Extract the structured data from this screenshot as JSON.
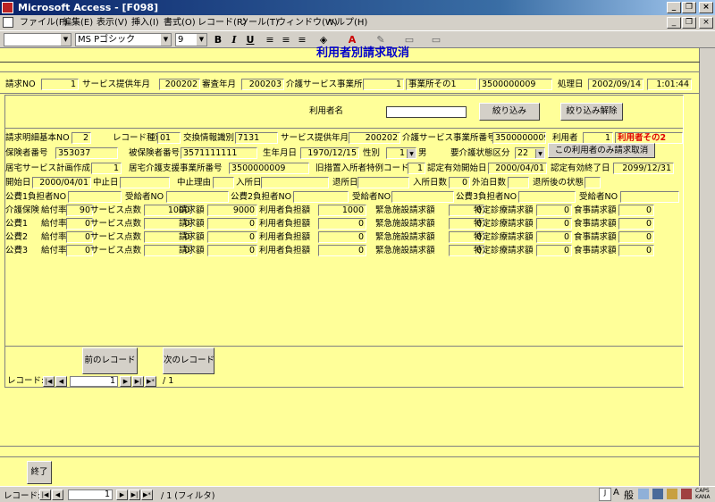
{
  "window": {
    "title": "Microsoft Access - [F098]"
  },
  "menu": [
    "ファイル(F)",
    "編集(E)",
    "表示(V)",
    "挿入(I)",
    "書式(O)",
    "レコード(R)",
    "ツール(T)",
    "ウィンドウ(W)",
    "ヘルプ(H)"
  ],
  "toolbar": {
    "font": "MS Pゴシック",
    "size": "9",
    "bold": "B",
    "italic": "I",
    "underline": "U"
  },
  "form": {
    "title": "利用者別請求取消"
  },
  "header": {
    "seikyu_no_label": "請求NO",
    "seikyu_no": "1",
    "service_month_label": "サービス提供年月",
    "service_month": "200202",
    "shinsa_month_label": "審査年月",
    "shinsa_month": "200203",
    "jigyosho_label": "介護サービス事業所",
    "jigyosho_id": "1",
    "jigyosho_name": "事業所その1",
    "jigyosho_no": "3500000009",
    "shori_label": "処理日",
    "shori_date": "2002/09/14",
    "shori_time": "1:01:44"
  },
  "filter": {
    "riyosha_label": "利用者名",
    "riyosha_value": "",
    "filter_btn": "絞り込み",
    "clear_btn": "絞り込み解除"
  },
  "detail": {
    "kihon_no_label": "請求明細基本NO",
    "kihon_no": "2",
    "record_type_label": "レコード種別",
    "record_type": "01",
    "koukan_label": "交換情報識別",
    "koukan": "7131",
    "service_month_label": "サービス提供年月",
    "service_month": "200202",
    "jigyosho_no_label": "介護サービス事業所番号",
    "jigyosho_no": "3500000009",
    "riyosha_label": "利用者",
    "riyosha_id": "1",
    "riyosha_name": "利用者その2",
    "hoken_label": "保険者番号",
    "hoken": "353037",
    "hihoken_label": "被保険者番号",
    "hihoken": "3571111111",
    "birth_label": "生年月日",
    "birth": "1970/12/15",
    "sex_label": "性別",
    "sex_code": "1",
    "sex": "男",
    "youkaigo_label": "要介護状態区分",
    "youkaigo": "22",
    "cancel_btn": "この利用者のみ請求取消",
    "kyotaku_label": "居宅サービス計画作成",
    "kyotaku": "1",
    "shien_label": "居宅介護支援事業所番号",
    "shien": "3500000009",
    "kyusochi_label": "旧措置入所者特例コード",
    "kyusochi": "1",
    "nintei_start_label": "認定有効開始日",
    "nintei_start": "2000/04/01",
    "nintei_end_label": "認定有効終了日",
    "nintei_end": "2099/12/31",
    "start_label": "開始日",
    "start": "2000/04/01",
    "chushi_label": "中止日",
    "chushi": "",
    "chushi_riyu_label": "中止理由",
    "chushi_riyu": "",
    "nyusho_label": "入所日",
    "nyusho": "",
    "taisho_label": "退所日",
    "taisho": "",
    "nyusho_days_label": "入所日数",
    "nyusho_days": "0",
    "gaihaku_label": "外泊日数",
    "gaihaku": "",
    "taishogo_label": "退所後の状態",
    "taishogo": "",
    "kohi1_label": "公費1負担者NO",
    "kohi1_jukyu_label": "受給者NO",
    "kohi2_label": "公費2負担者NO",
    "kohi2_jukyu_label": "受給者NO",
    "kohi3_label": "公費3負担者NO",
    "kohi3_jukyu_label": "受給者NO"
  },
  "billing_labels": {
    "kyufu": "給付率",
    "tensu": "サービス点数",
    "seikyu": "請求額",
    "futan": "利用者負担額",
    "kinkyu": "緊急施設請求額",
    "tokutei": "特定診療請求額",
    "shokuji": "食事請求額"
  },
  "billing": [
    {
      "name": "介護保険",
      "kyufu": "90",
      "tensu": "1000",
      "seikyu": "9000",
      "futan": "1000",
      "kinkyu": "0",
      "tokutei": "0",
      "shokuji": "0"
    },
    {
      "name": "公費1",
      "kyufu": "0",
      "tensu": "0",
      "seikyu": "0",
      "futan": "0",
      "kinkyu": "0",
      "tokutei": "0",
      "shokuji": "0"
    },
    {
      "name": "公費2",
      "kyufu": "0",
      "tensu": "0",
      "seikyu": "0",
      "futan": "0",
      "kinkyu": "0",
      "tokutei": "0",
      "shokuji": "0"
    },
    {
      "name": "公費3",
      "kyufu": "0",
      "tensu": "0",
      "seikyu": "0",
      "futan": "0",
      "kinkyu": "0",
      "tokutei": "0",
      "shokuji": "0"
    }
  ],
  "subnav": {
    "prev": "前のレコード",
    "next": "次のレコード",
    "record_label": "レコード:",
    "current": "1",
    "total": "/ 1"
  },
  "footer": {
    "exit": "終了"
  },
  "mainnav": {
    "record_label": "レコード:",
    "current": "1",
    "total": "/ 1 (フィルタ)"
  },
  "ime": {
    "mode": "般"
  }
}
